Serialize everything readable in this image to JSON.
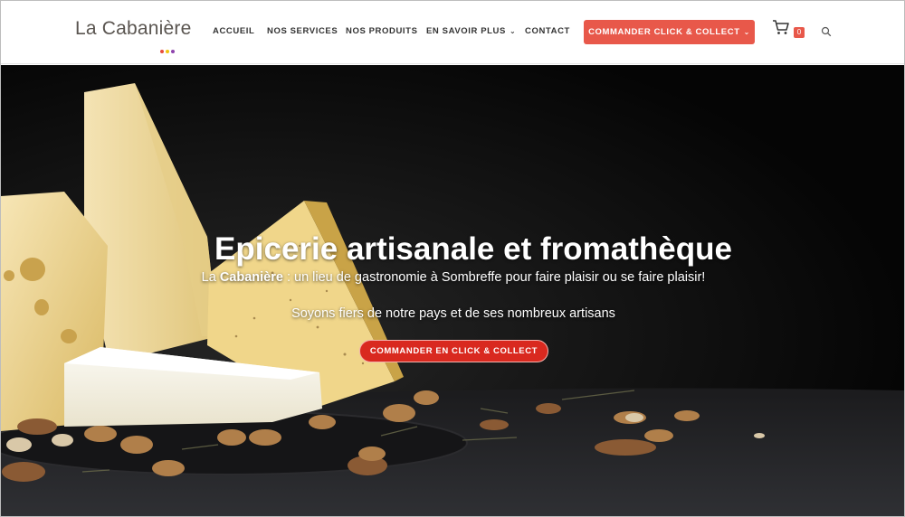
{
  "brand": {
    "name_part1": "La ",
    "name_part2": "Cabanière",
    "dot_colors": [
      "#e74c3c",
      "#f1c40f",
      "#8e44ad"
    ]
  },
  "nav": {
    "items": [
      {
        "label": "ACCUEIL",
        "has_dropdown": false
      },
      {
        "label": "NOS SERVICES",
        "has_dropdown": false
      },
      {
        "label": "NOS PRODUITS",
        "has_dropdown": false
      },
      {
        "label": "EN SAVOIR PLUS",
        "has_dropdown": true
      },
      {
        "label": "CONTACT",
        "has_dropdown": false
      }
    ],
    "cta_label": "COMMANDER CLICK & COLLECT",
    "cart_count": "0"
  },
  "hero": {
    "title": "Epicerie artisanale et fromathèque",
    "subtitle_prefix": "La ",
    "subtitle_brand": "Cabanière",
    "subtitle_rest": " : un lieu de gastronomie à Sombreffe pour faire plaisir ou se faire plaisir!",
    "tagline": "Soyons fiers de notre pays et de ses nombreux artisans",
    "cta_label": "COMMANDER EN CLICK & COLLECT"
  },
  "colors": {
    "accent": "#e8584a",
    "hero_button": "#d9291f",
    "header_bg": "#ffffff",
    "hero_bg": "#0a0a0a"
  },
  "icons": [
    "cart-icon",
    "search-icon",
    "chevron-down-icon"
  ]
}
